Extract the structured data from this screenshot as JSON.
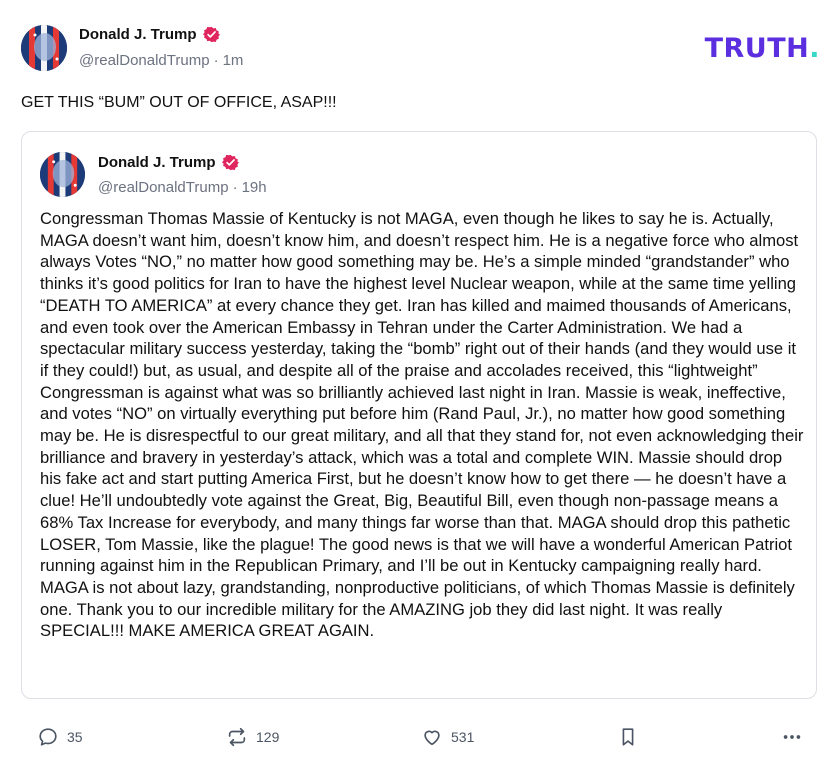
{
  "brand": {
    "text": "TRUTH",
    "dot": "."
  },
  "post": {
    "author_name": "Donald J. Trump",
    "handle": "@realDonaldTrump",
    "separator": "·",
    "time": "1m",
    "text": "GET THIS “BUM” OUT OF OFFICE, ASAP!!!"
  },
  "quote": {
    "author_name": "Donald J. Trump",
    "handle": "@realDonaldTrump",
    "separator": "·",
    "time": "19h",
    "body": "Congressman Thomas Massie of Kentucky is not MAGA, even though he likes to say he is. Actually, MAGA doesn’t want him, doesn’t know him, and doesn’t respect him. He is a negative force who almost always Votes “NO,” no matter how good something may be. He’s a simple minded “grandstander” who thinks it’s good politics for Iran to have the highest level Nuclear weapon, while at the same time yelling “DEATH TO AMERICA” at every chance they get. Iran has killed and maimed thousands of Americans, and even took over the American Embassy in Tehran under the Carter Administration. We had a spectacular military success yesterday, taking the “bomb” right out of their hands (and they would use it if they could!) but, as usual, and despite all of the praise and accolades received, this “lightweight” Congressman is against what was so brilliantly achieved last night in Iran. Massie is weak, ineffective, and votes “NO” on virtually everything put before him (Rand Paul, Jr.), no matter how good something may be. He is disrespectful to our great military, and all that they stand for, not even acknowledging their brilliance and bravery in yesterday’s attack, which was a total and complete WIN. Massie should drop his fake act and start putting America First, but he doesn’t know how to get there — he doesn’t have a clue! He’ll undoubtedly vote against the Great, Big, Beautiful Bill, even though non-passage means a 68% Tax Increase for everybody, and many things far worse than that. MAGA should drop this pathetic LOSER, Tom Massie, like the plague! The good news is that we will have a wonderful American Patriot running against him in the Republican Primary, and I’ll be out in Kentucky campaigning really hard. MAGA is not about lazy, grandstanding, nonproductive politicians, of which Thomas Massie is definitely one. Thank you to our incredible military for the AMAZING job they did last night. It was really SPECIAL!!! MAKE AMERICA GREAT AGAIN."
  },
  "actions": {
    "replies": "35",
    "retruths": "129",
    "likes": "531"
  },
  "icons": {
    "reply": "comment-bubble-icon",
    "retruth": "repost-arrows-icon",
    "like": "heart-icon",
    "save": "bookmark-icon",
    "more": "ellipsis-icon",
    "verified": "verified-badge-icon"
  },
  "colors": {
    "brand_purple": "#5b2ee0",
    "brand_teal": "#38d9c8",
    "verified_red": "#e0245e",
    "muted_text": "#6b7280"
  }
}
